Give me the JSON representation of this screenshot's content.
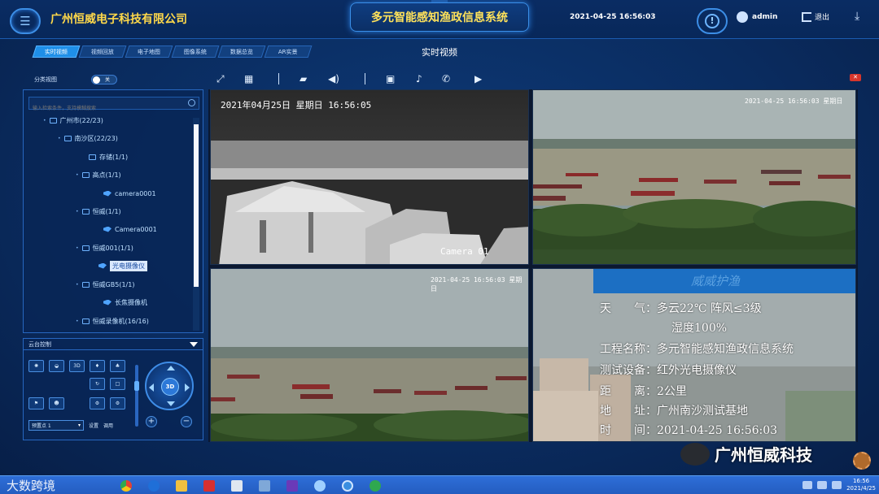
{
  "header": {
    "company": "广州恒威电子科技有限公司",
    "title": "多元智能感知渔政信息系统",
    "datetime": "2021-04-25 16:56:03",
    "user": "admin",
    "logout": "退出"
  },
  "tabs": [
    {
      "label": "实时视频",
      "active": true
    },
    {
      "label": "视频回放",
      "active": false
    },
    {
      "label": "电子地图",
      "active": false
    },
    {
      "label": "图像系统",
      "active": false
    },
    {
      "label": "数据总览",
      "active": false
    },
    {
      "label": "AR实景",
      "active": false
    }
  ],
  "page_title": "实时视频",
  "left": {
    "category_label": "分类视图",
    "toggle_text": "关",
    "search_placeholder": "输入检索条件，支持模糊搜索",
    "tree": [
      {
        "label": "广州市(22/23)",
        "level": 1,
        "kind": "folder"
      },
      {
        "label": "南沙区(22/23)",
        "level": 2,
        "kind": "folder"
      },
      {
        "label": "存储(1/1)",
        "level": 3,
        "kind": "group"
      },
      {
        "label": "高点(1/1)",
        "level": 3,
        "kind": "group"
      },
      {
        "label": "camera0001",
        "level": 4,
        "kind": "camera"
      },
      {
        "label": "恒威(1/1)",
        "level": 3,
        "kind": "group"
      },
      {
        "label": "Camera0001",
        "level": 4,
        "kind": "camera"
      },
      {
        "label": "恒威001(1/1)",
        "level": 3,
        "kind": "group"
      },
      {
        "label": "光电摄像仪",
        "level": 4,
        "kind": "camera",
        "selected": true
      },
      {
        "label": "恒威GB5(1/1)",
        "level": 3,
        "kind": "group"
      },
      {
        "label": "长焦摄像机",
        "level": 4,
        "kind": "camera"
      },
      {
        "label": "恒威录像机(16/16)",
        "level": 3,
        "kind": "group"
      }
    ],
    "ptz": {
      "title": "云台控制",
      "btn_3d": "3D",
      "joystick_label": "3D",
      "preset_value": "预置点 1",
      "set_label": "设置",
      "call_label": "调用"
    }
  },
  "videos": {
    "cell1_timestamp": "2021年04月25日  星期日  16:56:05",
    "cell1_camera": "Camera 01",
    "cell2_osd": "2021-04-25 16:56:03 星期日",
    "cell3_osd": "2021-04-25 16:56:03 星期日",
    "info": {
      "banner": "威威护渔",
      "weather_label": "天　　气：",
      "weather_value": "多云22℃ 阵风≤3级",
      "humidity": "湿度100%",
      "project_label": "工程名称：",
      "project_value": "多元智能感知渔政信息系统",
      "device_label": "测试设备：",
      "device_value": "红外光电摄像仪",
      "distance_label": "距　　离：",
      "distance_value": "2公里",
      "address_label": "地　　址：",
      "address_value": "广州南沙测试基地",
      "time_label": "时　　间：",
      "time_value": "2021-04-25 16:56:03"
    }
  },
  "watermark": "广州恒威科技",
  "taskbar": {
    "left_text": "大数跨境",
    "clock_time": "16:56",
    "clock_date": "2021/4/25"
  },
  "colors": {
    "accent": "#1f8fe8",
    "title_yellow": "#ffd94a",
    "panel_border": "#2767c0",
    "close_red": "#d6362c"
  }
}
